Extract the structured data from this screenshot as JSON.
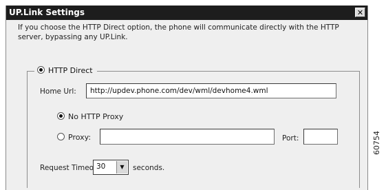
{
  "window": {
    "title": "UP.Link Settings",
    "close_glyph": "✕"
  },
  "description": "If you choose the HTTP Direct option, the phone will communicate directly with the HTTP server, bypassing any UP.Link.",
  "group": {
    "legend": "HTTP Direct",
    "home_url_label": "Home Url:",
    "home_url_value": "http://updev.phone.com/dev/wml/devhome4.wml",
    "no_proxy_label": "No HTTP Proxy",
    "proxy_label": "Proxy:",
    "proxy_value": "",
    "port_label": "Port:",
    "port_value": "",
    "timeout_label": "Request Timeout:",
    "timeout_value": "30",
    "timeout_units": "seconds."
  },
  "figure_id": "60754"
}
